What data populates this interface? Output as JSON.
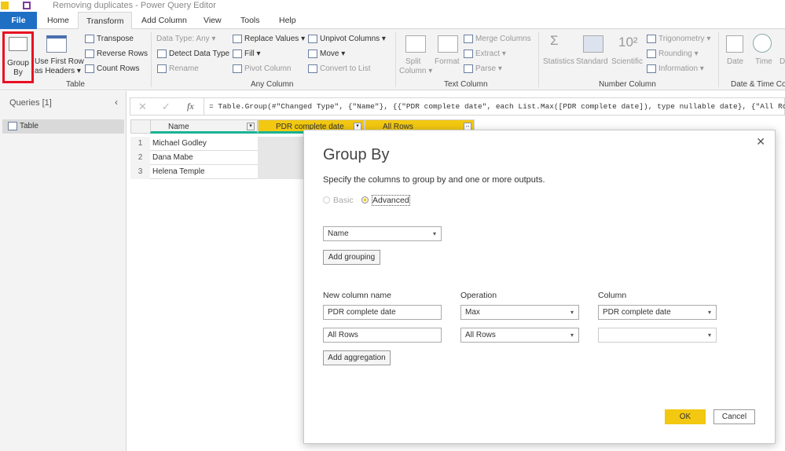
{
  "window": {
    "title": "Removing duplicates - Power Query Editor"
  },
  "tabs": [
    "File",
    "Home",
    "Transform",
    "Add Column",
    "View",
    "Tools",
    "Help"
  ],
  "ribbon": {
    "table": {
      "group_by": [
        "Group",
        "By"
      ],
      "use_first_row": [
        "Use First Row",
        "as Headers ▾"
      ],
      "transpose": "Transpose",
      "reverse_rows": "Reverse Rows",
      "count_rows": "Count Rows",
      "label": "Table"
    },
    "any_column": {
      "data_type": "Data Type: Any ▾",
      "detect": "Detect Data Type",
      "rename": "Rename",
      "replace": "Replace Values ▾",
      "fill": "Fill ▾",
      "pivot": "Pivot Column",
      "unpivot": "Unpivot Columns ▾",
      "move": "Move ▾",
      "convert": "Convert to List",
      "label": "Any Column"
    },
    "text_column": {
      "split": [
        "Split",
        "Column ▾"
      ],
      "format": "Format",
      "merge": "Merge Columns",
      "extract": "Extract ▾",
      "parse": "Parse ▾",
      "label": "Text Column"
    },
    "number_column": {
      "statistics": "Statistics",
      "standard": "Standard",
      "scientific": "Scientific",
      "trig": "Trigonometry ▾",
      "rounding": "Rounding ▾",
      "information": "Information ▾",
      "label": "Number Column"
    },
    "datetime": {
      "date": "Date",
      "time": "Time",
      "d": "D",
      "label": "Date & Time Co"
    }
  },
  "queries": {
    "title": "Queries [1]",
    "items": [
      "Table"
    ]
  },
  "formula": "= Table.Group(#\"Changed Type\", {\"Name\"}, {{\"PDR complete date\", each List.Max([PDR complete date]), type nullable date}, {\"All Ro",
  "grid": {
    "columns": [
      "Name",
      "PDR complete date",
      "All Rows"
    ],
    "rows": [
      [
        "1",
        "Michael Godley"
      ],
      [
        "2",
        "Dana Mabe"
      ],
      [
        "3",
        "Helena Temple"
      ]
    ]
  },
  "dialog": {
    "title": "Group By",
    "description": "Specify the columns to group by and one or more outputs.",
    "basic": "Basic",
    "advanced": "Advanced",
    "mode": "Advanced",
    "grouping": "Name",
    "add_grouping": "Add grouping",
    "headers": [
      "New column name",
      "Operation",
      "Column"
    ],
    "aggregations": [
      {
        "name": "PDR complete date",
        "operation": "Max",
        "column": "PDR complete date"
      },
      {
        "name": "All Rows",
        "operation": "All Rows",
        "column": ""
      }
    ],
    "add_aggregation": "Add aggregation",
    "ok": "OK",
    "cancel": "Cancel"
  },
  "colors": {
    "accent": "#f2c811",
    "file_tab": "#1f6fc5",
    "highlight": "#e81123"
  }
}
